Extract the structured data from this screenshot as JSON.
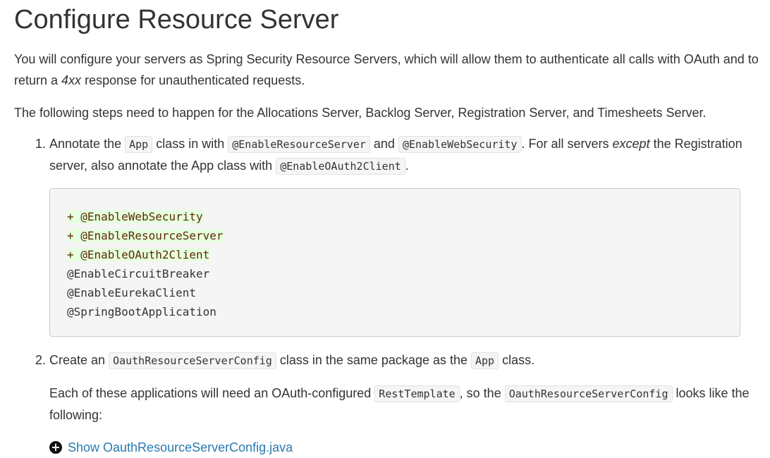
{
  "heading": "Configure Resource Server",
  "intro": {
    "before": "You will configure your servers as Spring Security Resource Servers, which will allow them to authenticate all calls with OAuth and to return a ",
    "em": "4xx",
    "after": " response for unauthenticated requests."
  },
  "steps_intro": "The following steps need to happen for the Allocations Server, Backlog Server, Registration Server, and Timesheets Server.",
  "step1": {
    "t1": "Annotate the ",
    "code1": "App",
    "t2": " class in with ",
    "code2": "@EnableResourceServer",
    "t3": " and ",
    "code3": "@EnableWebSecurity",
    "t4": ". For all servers ",
    "em": "except",
    "t5": " the Registration server, also annotate the App class with ",
    "code4": "@EnableOAuth2Client",
    "t6": "."
  },
  "code_block": {
    "added_prefix": "+ ",
    "added": [
      "@EnableWebSecurity",
      "@EnableResourceServer",
      "@EnableOAuth2Client"
    ],
    "unchanged": [
      "@EnableCircuitBreaker",
      "@EnableEurekaClient",
      "@SpringBootApplication"
    ]
  },
  "step2": {
    "t1": "Create an ",
    "code1": "OauthResourceServerConfig",
    "t2": " class in the same package as the ",
    "code2": "App",
    "t3": " class.",
    "para": {
      "t1": "Each of these applications will need an OAuth-configured ",
      "code1": "RestTemplate",
      "t2": ", so the ",
      "code2": "OauthResourceServerConfig",
      "t3": " looks like the following:"
    },
    "toggle_label": "Show OauthResourceServerConfig.java"
  },
  "icons": {
    "toggle": "plus-circle-icon"
  }
}
